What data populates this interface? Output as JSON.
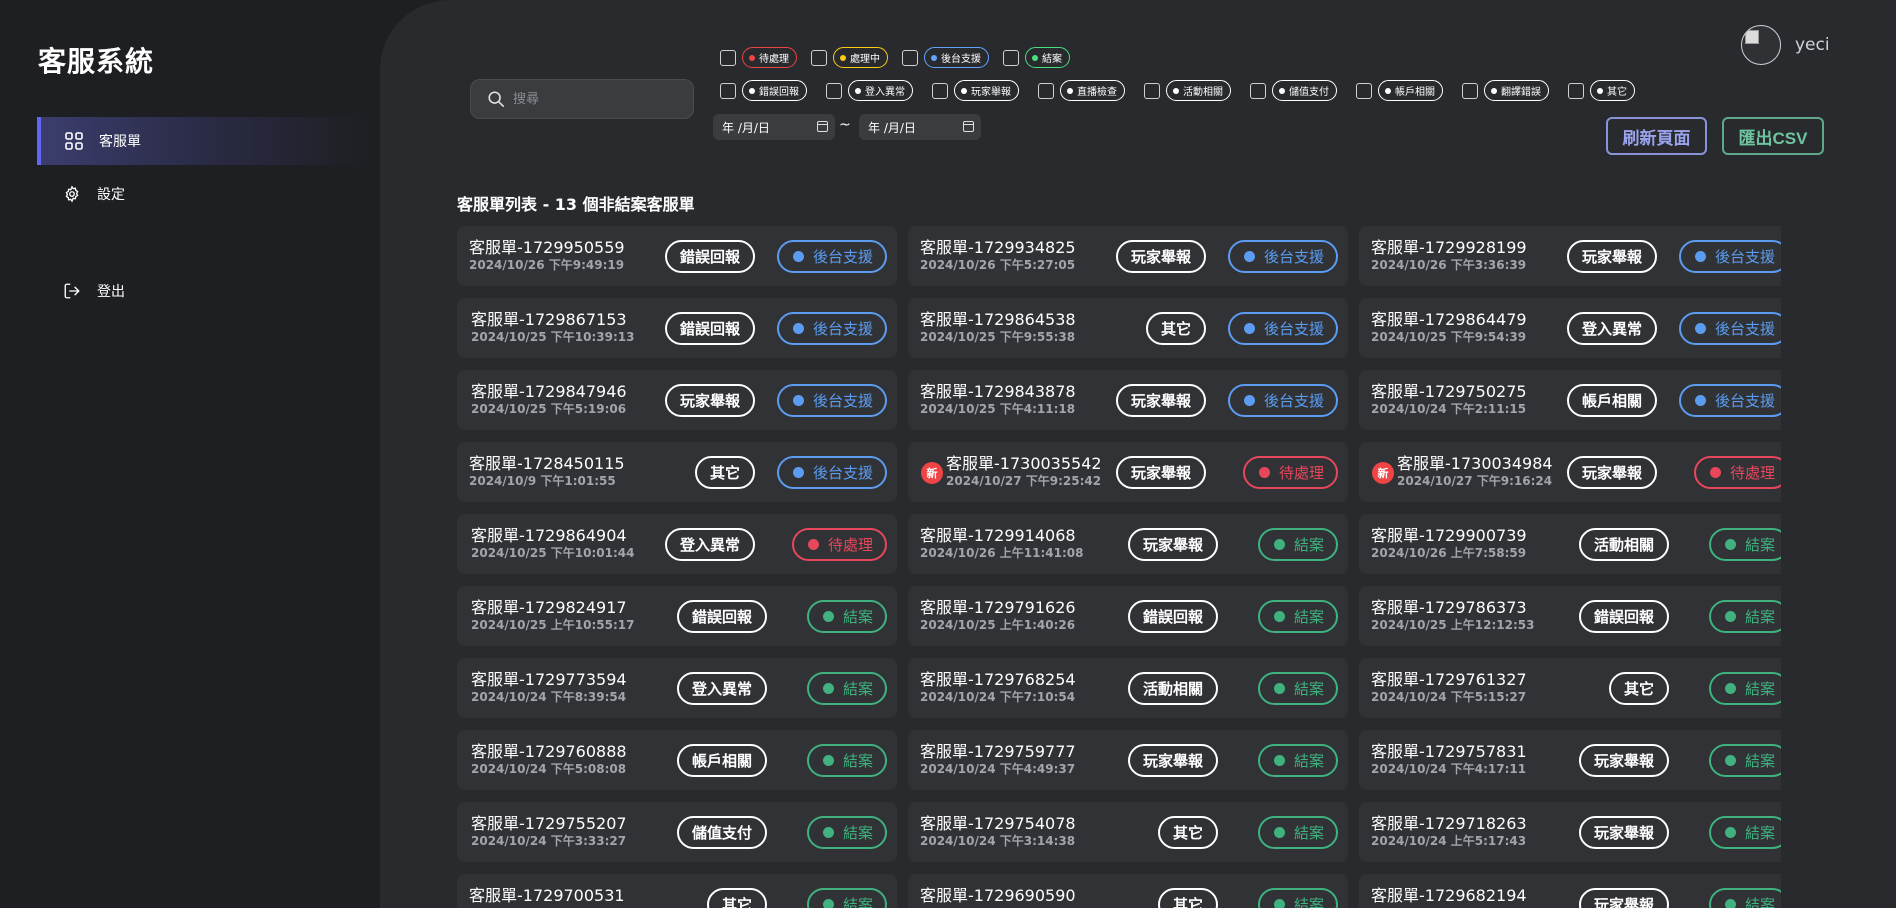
{
  "app": {
    "title": "客服系統"
  },
  "sidebar": {
    "items": [
      {
        "label": "客服單",
        "icon": "grid-icon",
        "active": true
      },
      {
        "label": "設定",
        "icon": "gear-icon",
        "active": false
      },
      {
        "label": "登出",
        "icon": "logout-icon",
        "active": false
      }
    ]
  },
  "search": {
    "placeholder": "搜尋"
  },
  "status_filters": [
    {
      "label": "待處理",
      "color": "#ef4444"
    },
    {
      "label": "處理中",
      "color": "#facc15"
    },
    {
      "label": "後台支援",
      "color": "#60a5fa"
    },
    {
      "label": "結案",
      "color": "#4ade80"
    }
  ],
  "category_filters": [
    "錯誤回報",
    "登入異常",
    "玩家舉報",
    "直播檢查",
    "活動相關",
    "儲值支付",
    "帳戶相關",
    "翻譯錯誤",
    "其它"
  ],
  "date_filter": {
    "start": "年 /月/日",
    "end": "年 /月/日",
    "separator": "~"
  },
  "actions": {
    "refresh": "刷新頁面",
    "export": "匯出CSV"
  },
  "user": {
    "name": "yeci"
  },
  "list": {
    "title": "客服單列表 - 13 個非結案客服單"
  },
  "colors": {
    "accent": "#6366f1",
    "pending": "#ef4444",
    "support": "#60a5fa",
    "closed": "#4ade80",
    "refresh": "#a5b4fc",
    "export": "#6ee7b7"
  },
  "status_styles": {
    "後台支援": {
      "color": "#5b9cf0"
    },
    "待處理": {
      "color": "#e8475b"
    },
    "結案": {
      "color": "#3fb27f"
    }
  },
  "tickets": [
    {
      "id": "客服單-1729950559",
      "time": "2024/10/26 下午9:49:19",
      "category": "錯誤回報",
      "status": "後台支援",
      "new": false
    },
    {
      "id": "客服單-1729934825",
      "time": "2024/10/26 下午5:27:05",
      "category": "玩家舉報",
      "status": "後台支援",
      "new": false
    },
    {
      "id": "客服單-1729928199",
      "time": "2024/10/26 下午3:36:39",
      "category": "玩家舉報",
      "status": "後台支援",
      "new": false
    },
    {
      "id": "客服單-1729867153",
      "time": "2024/10/25 下午10:39:13",
      "category": "錯誤回報",
      "status": "後台支援",
      "new": false
    },
    {
      "id": "客服單-1729864538",
      "time": "2024/10/25 下午9:55:38",
      "category": "其它",
      "status": "後台支援",
      "new": false
    },
    {
      "id": "客服單-1729864479",
      "time": "2024/10/25 下午9:54:39",
      "category": "登入異常",
      "status": "後台支援",
      "new": false
    },
    {
      "id": "客服單-1729847946",
      "time": "2024/10/25 下午5:19:06",
      "category": "玩家舉報",
      "status": "後台支援",
      "new": false
    },
    {
      "id": "客服單-1729843878",
      "time": "2024/10/25 下午4:11:18",
      "category": "玩家舉報",
      "status": "後台支援",
      "new": false
    },
    {
      "id": "客服單-1729750275",
      "time": "2024/10/24 下午2:11:15",
      "category": "帳戶相關",
      "status": "後台支援",
      "new": false
    },
    {
      "id": "客服單-1728450115",
      "time": "2024/10/9 下午1:01:55",
      "category": "其它",
      "status": "後台支援",
      "new": false
    },
    {
      "id": "客服單-1730035542",
      "time": "2024/10/27 下午9:25:42",
      "category": "玩家舉報",
      "status": "待處理",
      "new": true
    },
    {
      "id": "客服單-1730034984",
      "time": "2024/10/27 下午9:16:24",
      "category": "玩家舉報",
      "status": "待處理",
      "new": true
    },
    {
      "id": "客服單-1729864904",
      "time": "2024/10/25 下午10:01:44",
      "category": "登入異常",
      "status": "待處理",
      "new": false
    },
    {
      "id": "客服單-1729914068",
      "time": "2024/10/26 上午11:41:08",
      "category": "玩家舉報",
      "status": "結案",
      "new": false
    },
    {
      "id": "客服單-1729900739",
      "time": "2024/10/26 上午7:58:59",
      "category": "活動相關",
      "status": "結案",
      "new": false
    },
    {
      "id": "客服單-1729824917",
      "time": "2024/10/25 上午10:55:17",
      "category": "錯誤回報",
      "status": "結案",
      "new": false
    },
    {
      "id": "客服單-1729791626",
      "time": "2024/10/25 上午1:40:26",
      "category": "錯誤回報",
      "status": "結案",
      "new": false
    },
    {
      "id": "客服單-1729786373",
      "time": "2024/10/25 上午12:12:53",
      "category": "錯誤回報",
      "status": "結案",
      "new": false
    },
    {
      "id": "客服單-1729773594",
      "time": "2024/10/24 下午8:39:54",
      "category": "登入異常",
      "status": "結案",
      "new": false
    },
    {
      "id": "客服單-1729768254",
      "time": "2024/10/24 下午7:10:54",
      "category": "活動相關",
      "status": "結案",
      "new": false
    },
    {
      "id": "客服單-1729761327",
      "time": "2024/10/24 下午5:15:27",
      "category": "其它",
      "status": "結案",
      "new": false
    },
    {
      "id": "客服單-1729760888",
      "time": "2024/10/24 下午5:08:08",
      "category": "帳戶相關",
      "status": "結案",
      "new": false
    },
    {
      "id": "客服單-1729759777",
      "time": "2024/10/24 下午4:49:37",
      "category": "玩家舉報",
      "status": "結案",
      "new": false
    },
    {
      "id": "客服單-1729757831",
      "time": "2024/10/24 下午4:17:11",
      "category": "玩家舉報",
      "status": "結案",
      "new": false
    },
    {
      "id": "客服單-1729755207",
      "time": "2024/10/24 下午3:33:27",
      "category": "儲值支付",
      "status": "結案",
      "new": false
    },
    {
      "id": "客服單-1729754078",
      "time": "2024/10/24 下午3:14:38",
      "category": "其它",
      "status": "結案",
      "new": false
    },
    {
      "id": "客服單-1729718263",
      "time": "2024/10/24 上午5:17:43",
      "category": "玩家舉報",
      "status": "結案",
      "new": false
    },
    {
      "id": "客服單-1729700531",
      "time": "",
      "category": "其它",
      "status": "結案",
      "new": false
    },
    {
      "id": "客服單-1729690590",
      "time": "",
      "category": "其它",
      "status": "結案",
      "new": false
    },
    {
      "id": "客服單-1729682194",
      "time": "",
      "category": "玩家舉報",
      "status": "結案",
      "new": false
    }
  ]
}
